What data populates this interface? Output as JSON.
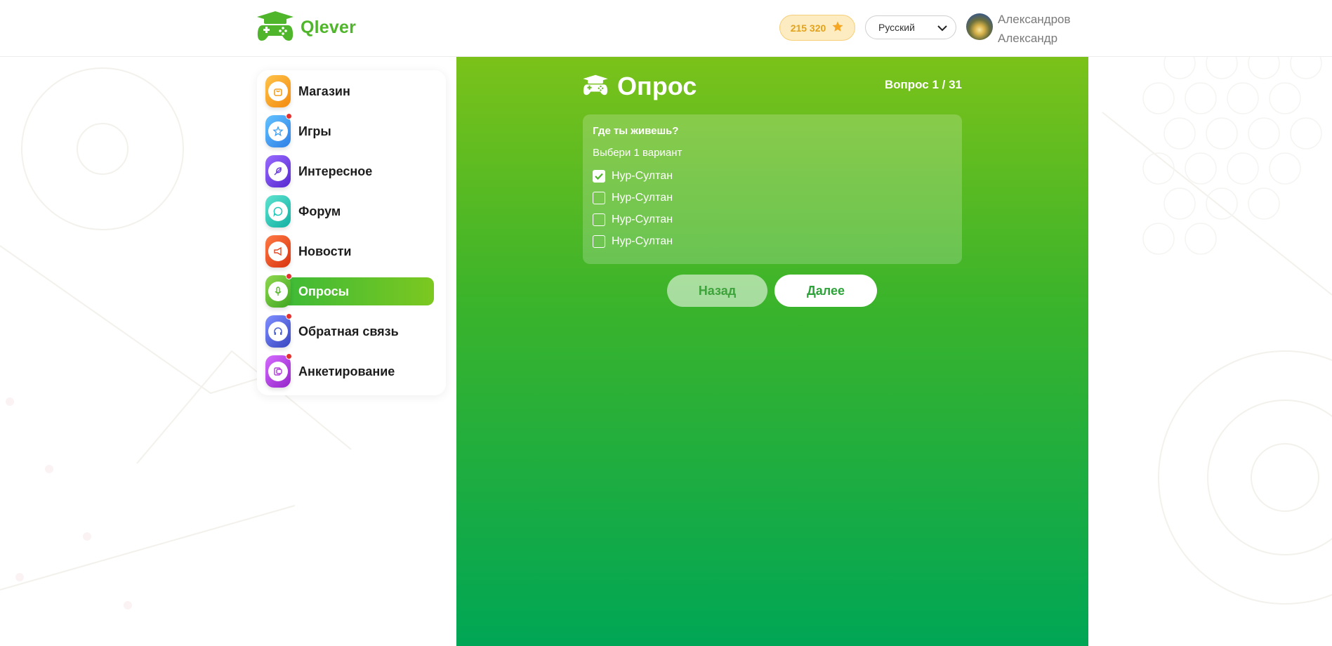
{
  "brand": {
    "name": "Qlever",
    "logo_icon": "gamepad-graduation-cap-icon"
  },
  "header": {
    "balance": "215 320",
    "balance_icon": "star-icon",
    "language": "Русский",
    "user": {
      "last_name": "Александров",
      "first_name": "Александр"
    }
  },
  "sidebar": {
    "items": [
      {
        "label": "Магазин",
        "icon": "shop-bag-icon",
        "color": "#f7a11a",
        "badge": false
      },
      {
        "label": "Игры",
        "icon": "star-icon",
        "color": "#3c9ef0",
        "badge": true
      },
      {
        "label": "Интересное",
        "icon": "feather-icon",
        "color": "#6b3fe0",
        "badge": false
      },
      {
        "label": "Форум",
        "icon": "chat-bubble-icon",
        "color": "#1ec8b6",
        "badge": false
      },
      {
        "label": "Новости",
        "icon": "megaphone-icon",
        "color": "#e8461f",
        "badge": false
      },
      {
        "label": "Опросы",
        "icon": "microphone-icon",
        "color": "#58b82e",
        "badge": true,
        "active": true
      },
      {
        "label": "Обратная связь",
        "icon": "headset-icon",
        "color": "#4c5fd0",
        "badge": true
      },
      {
        "label": "Анкетирование",
        "icon": "form-icon",
        "color": "#b03bd9",
        "badge": true
      }
    ]
  },
  "survey": {
    "title": "Опрос",
    "counter": "Вопрос 1 / 31",
    "question": "Где ты живешь?",
    "hint": "Выбери 1 вариант",
    "options": [
      {
        "label": "Нур-Султан",
        "checked": true
      },
      {
        "label": "Нур-Султан",
        "checked": false
      },
      {
        "label": "Нур-Султан",
        "checked": false
      },
      {
        "label": "Нур-Султан",
        "checked": false
      }
    ],
    "back_label": "Назад",
    "next_label": "Далее"
  },
  "colors": {
    "brand_green": "#4fb52a",
    "gradient_top": "#7bc21a",
    "gradient_bottom": "#00a655",
    "balance_bg": "#fdebc2",
    "balance_text": "#e2a31c",
    "badge_red": "#e4312f"
  }
}
